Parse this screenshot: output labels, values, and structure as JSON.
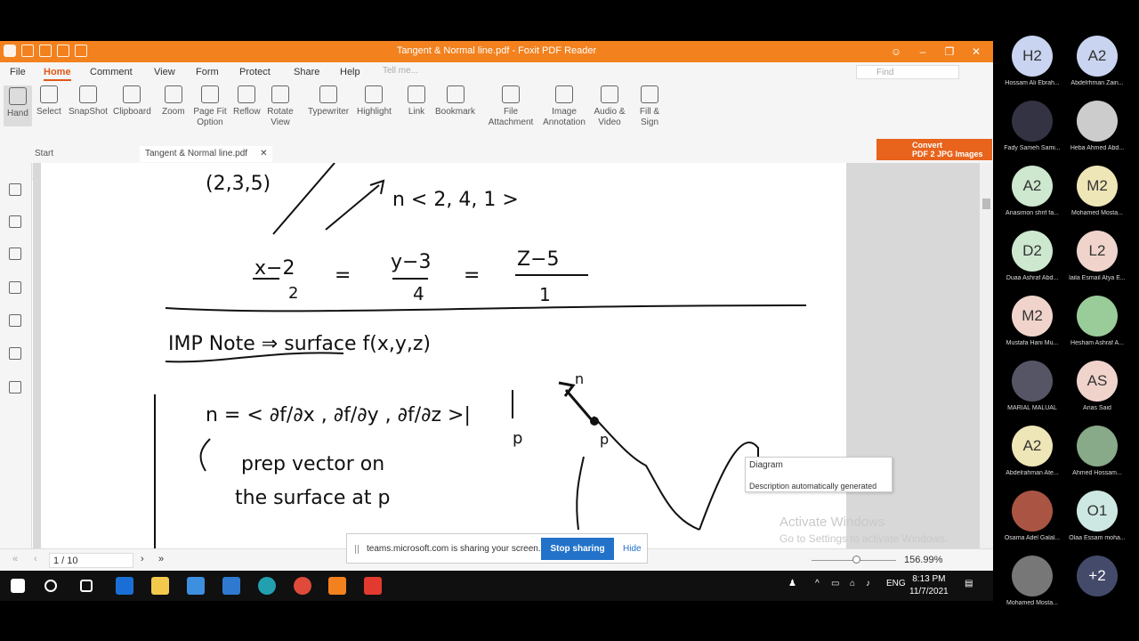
{
  "window": {
    "title": "Tangent & Normal line.pdf - Foxit PDF Reader"
  },
  "menu": [
    "File",
    "Home",
    "Comment",
    "View",
    "Form",
    "Protect",
    "Share",
    "Help"
  ],
  "tell_me": "Tell me...",
  "find_placeholder": "Find",
  "ribbon": [
    {
      "label": "Hand",
      "icon": "hand-icon"
    },
    {
      "label": "Select",
      "icon": "select-icon"
    },
    {
      "label": "SnapShot",
      "icon": "snapshot-icon"
    },
    {
      "label": "Clipboard",
      "icon": "clipboard-icon"
    },
    {
      "label": "Zoom",
      "icon": "zoom-icon"
    },
    {
      "label": "Page Fit Option",
      "icon": "page-fit-icon"
    },
    {
      "label": "Reflow",
      "icon": "reflow-icon"
    },
    {
      "label": "Rotate View",
      "icon": "rotate-icon"
    },
    {
      "label": "Typewriter",
      "icon": "typewriter-icon"
    },
    {
      "label": "Highlight",
      "icon": "highlight-icon"
    },
    {
      "label": "Link",
      "icon": "link-icon"
    },
    {
      "label": "Bookmark",
      "icon": "bookmark-icon"
    },
    {
      "label": "File Attachment",
      "icon": "attachment-icon"
    },
    {
      "label": "Image Annotation",
      "icon": "image-icon"
    },
    {
      "label": "Audio & Video",
      "icon": "media-icon"
    },
    {
      "label": "Fill & Sign",
      "icon": "sign-icon"
    }
  ],
  "convert": {
    "line1": "Convert",
    "line2": "PDF 2 JPG Images"
  },
  "tabs": {
    "start": "Start",
    "current": "Tangent & Normal line.pdf"
  },
  "status": {
    "page": "1 / 10",
    "zoom": "156.99%"
  },
  "tooltip": {
    "line1": "Diagram",
    "line2": "Description automatically generated"
  },
  "activate": {
    "line1": "Activate Windows",
    "line2": "Go to Settings to activate Windows."
  },
  "share": {
    "text": "teams.microsoft.com is sharing your screen.",
    "stop": "Stop sharing",
    "hide": "Hide"
  },
  "clock": {
    "time": "8:13 PM",
    "date": "11/7/2021",
    "lang": "ENG"
  },
  "participants": [
    {
      "initials": "H2",
      "name": "Hossam Ali Ebrah...",
      "color": "#c9d4f0"
    },
    {
      "initials": "A2",
      "name": "Abdelrhman Zain...",
      "color": "#c9d4f0"
    },
    {
      "initials": "",
      "name": "Fady Sameh Sami...",
      "color": "#334"
    },
    {
      "initials": "",
      "name": "Heba Ahmed Abd...",
      "color": "#ccc"
    },
    {
      "initials": "A2",
      "name": "Anasimon shrif fa...",
      "color": "#cde8cf"
    },
    {
      "initials": "M2",
      "name": "Mohamed Mosta...",
      "color": "#efe6b8"
    },
    {
      "initials": "D2",
      "name": "Duaa Ashraf Abd...",
      "color": "#cde8cf"
    },
    {
      "initials": "L2",
      "name": "laila Esmail Atya E...",
      "color": "#f0d4cc"
    },
    {
      "initials": "M2",
      "name": "Mustafa Hani Mu...",
      "color": "#f0d4cc"
    },
    {
      "initials": "",
      "name": "Hesham Ashraf A...",
      "color": "#9c9"
    },
    {
      "initials": "",
      "name": "MARIAL MALUAL",
      "color": "#556"
    },
    {
      "initials": "AS",
      "name": "Anas Said",
      "color": "#f0d4cc"
    },
    {
      "initials": "A2",
      "name": "Abdelrahman Ate...",
      "color": "#efe6b8"
    },
    {
      "initials": "",
      "name": "Ahmed Hossam...",
      "color": "#8a8"
    },
    {
      "initials": "",
      "name": "Osama Adel Galal...",
      "color": "#a54"
    },
    {
      "initials": "O1",
      "name": "Olaa Essam moha...",
      "color": "#cde8e2"
    },
    {
      "initials": "",
      "name": "Mohamed Mosta...",
      "color": "#777"
    },
    {
      "initials": "+2",
      "name": "",
      "color": "#444a6a"
    }
  ]
}
